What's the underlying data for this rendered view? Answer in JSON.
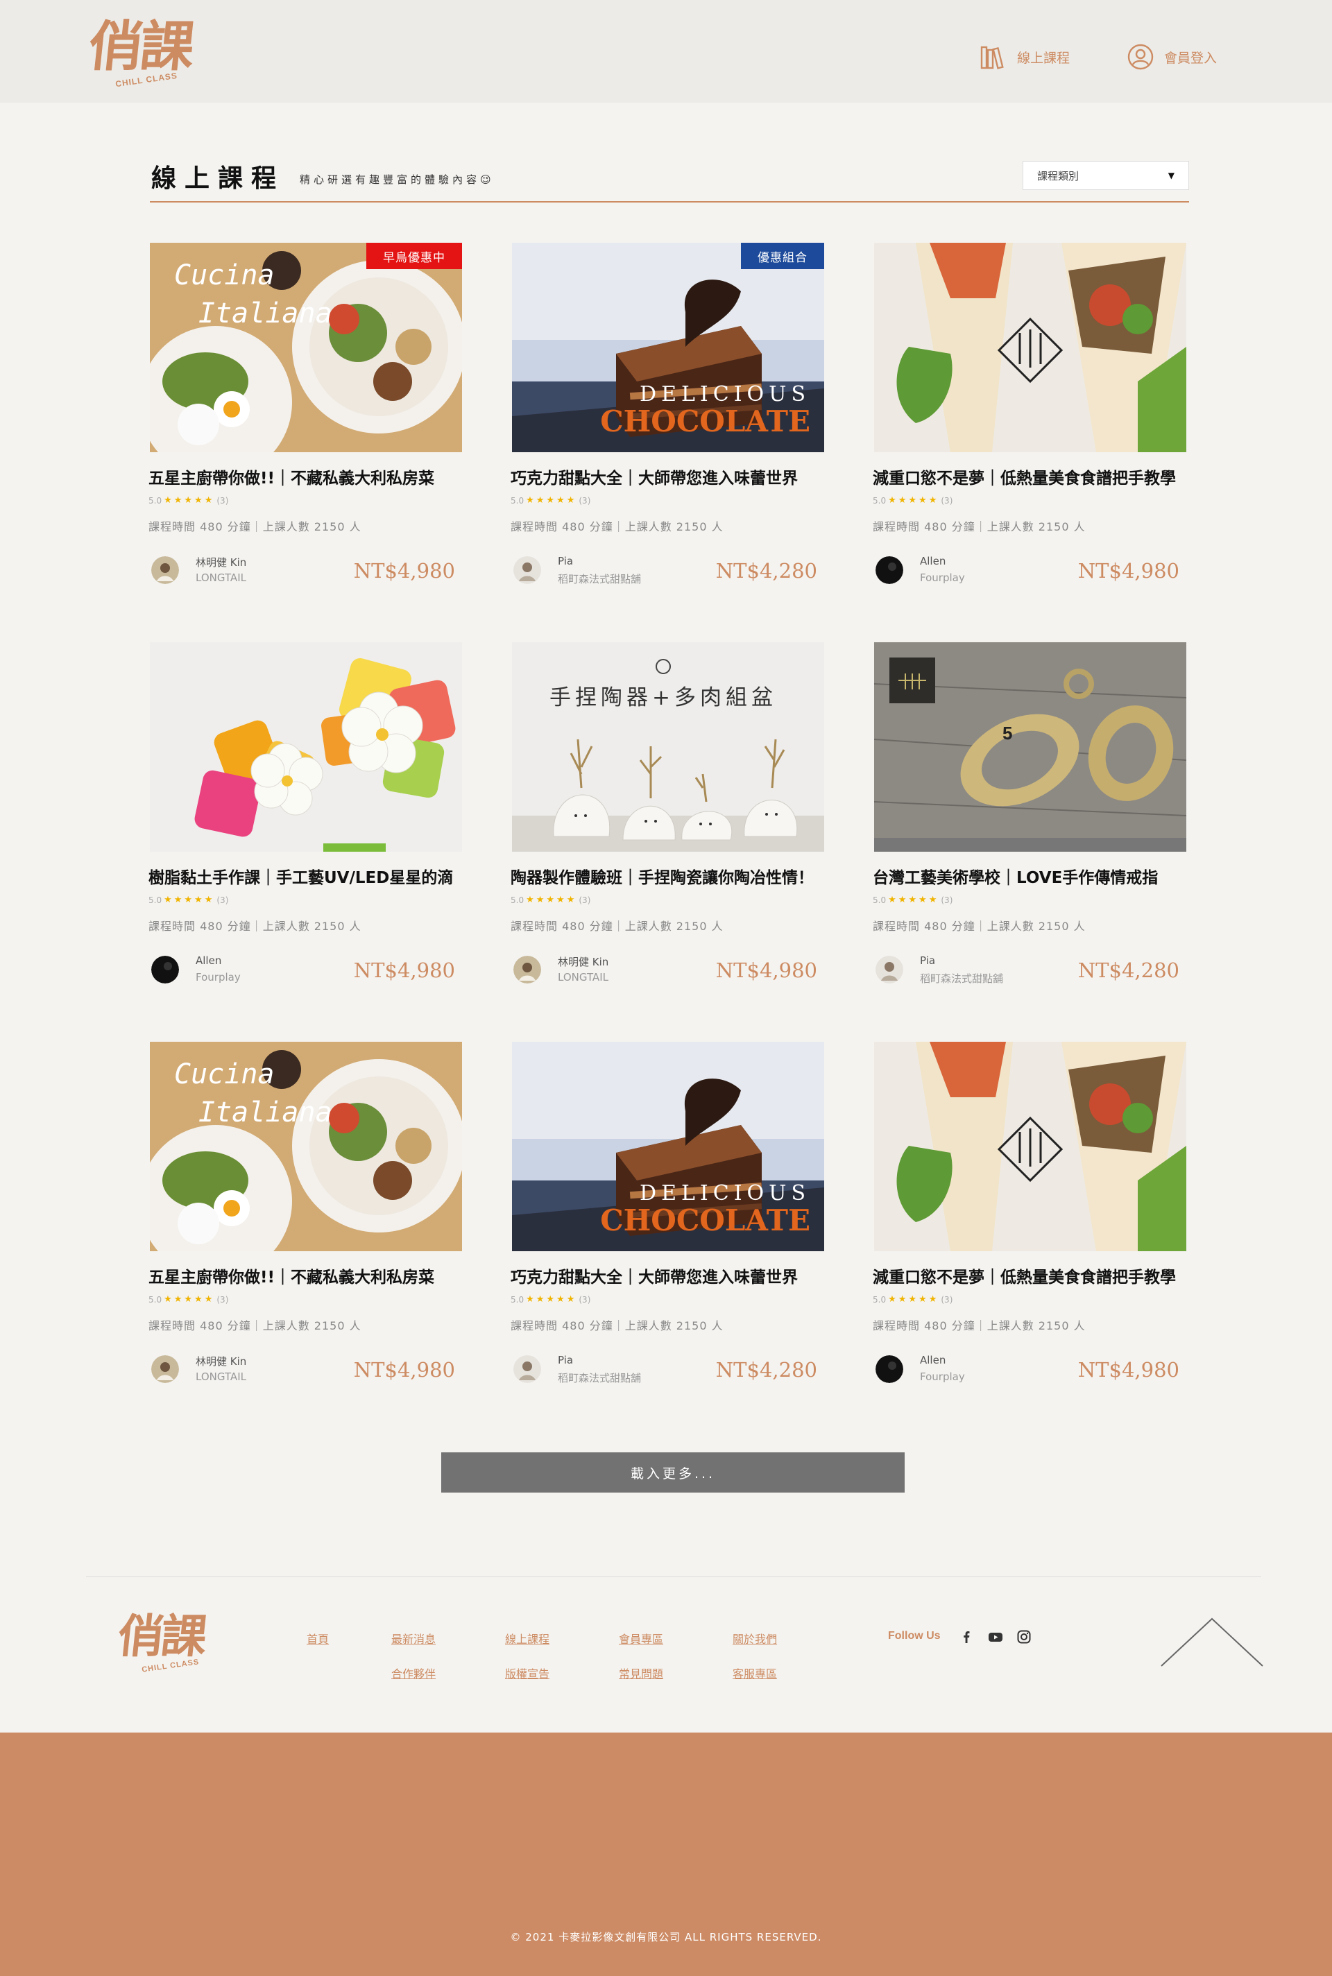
{
  "header": {
    "logo_text": "俏課",
    "logo_sub": "CHILL CLASS",
    "nav": [
      {
        "label": "線上課程",
        "icon": "books-icon"
      },
      {
        "label": "會員登入",
        "icon": "user-icon"
      }
    ]
  },
  "section": {
    "title": "線上課程",
    "subtitle": "精心研選有趣豐富的體驗內容😉",
    "category_select": "課程類別"
  },
  "courses": [
    {
      "title": "五星主廚帶你做!!｜不藏私義大利私房菜",
      "rating": "5.0",
      "reviews": "(3)",
      "meta": "課程時間  480  分鐘｜上課人數  2150  人",
      "teacher": "林明健 Kin",
      "org": "LONGTAIL",
      "price": "NT$4,980",
      "badge": "早鳥優惠中",
      "image": "italian-food"
    },
    {
      "title": "巧克力甜點大全｜大師帶您進入味蕾世界",
      "rating": "5.0",
      "reviews": "(3)",
      "meta": "課程時間  480  分鐘｜上課人數  2150  人",
      "teacher": "Pia",
      "org": "稻町森法式甜點舖",
      "price": "NT$4,280",
      "badge": "優惠組合",
      "image": "chocolate-cake",
      "image_text_1": "DELICIOUS",
      "image_text_2": "CHOCOLATE"
    },
    {
      "title": "減重口慾不是夢｜低熱量美食食譜把手教學",
      "rating": "5.0",
      "reviews": "(3)",
      "meta": "課程時間  480  分鐘｜上課人數  2150  人",
      "teacher": "Allen",
      "org": "Fourplay",
      "price": "NT$4,980",
      "image": "wraps"
    },
    {
      "title": "樹脂黏土手作課｜手工藝UV/LED星星的滴",
      "rating": "5.0",
      "reviews": "(3)",
      "meta": "課程時間  480  分鐘｜上課人數  2150  人",
      "teacher": "Allen",
      "org": "Fourplay",
      "price": "NT$4,980",
      "image": "resin-craft"
    },
    {
      "title": "陶器製作體驗班｜手捏陶瓷讓你陶冶性情！",
      "rating": "5.0",
      "reviews": "(3)",
      "meta": "課程時間  480  分鐘｜上課人數  2150  人",
      "teacher": "林明健 Kin",
      "org": "LONGTAIL",
      "price": "NT$4,980",
      "image": "pottery",
      "image_text_1": "手捏陶器+多肉組盆"
    },
    {
      "title": "台灣工藝美術學校｜LOVE手作傳情戒指",
      "rating": "5.0",
      "reviews": "(3)",
      "meta": "課程時間  480  分鐘｜上課人數  2150  人",
      "teacher": "Pia",
      "org": "稻町森法式甜點舖",
      "price": "NT$4,280",
      "image": "tape-rings"
    },
    {
      "title": "五星主廚帶你做!!｜不藏私義大利私房菜",
      "rating": "5.0",
      "reviews": "(3)",
      "meta": "課程時間  480  分鐘｜上課人數  2150  人",
      "teacher": "林明健 Kin",
      "org": "LONGTAIL",
      "price": "NT$4,980",
      "image": "italian-food"
    },
    {
      "title": "巧克力甜點大全｜大師帶您進入味蕾世界",
      "rating": "5.0",
      "reviews": "(3)",
      "meta": "課程時間  480  分鐘｜上課人數  2150  人",
      "teacher": "Pia",
      "org": "稻町森法式甜點舖",
      "price": "NT$4,280",
      "image": "chocolate-cake",
      "image_text_1": "DELICIOUS",
      "image_text_2": "CHOCOLATE"
    },
    {
      "title": "減重口慾不是夢｜低熱量美食食譜把手教學",
      "rating": "5.0",
      "reviews": "(3)",
      "meta": "課程時間  480  分鐘｜上課人數  2150  人",
      "teacher": "Allen",
      "org": "Fourplay",
      "price": "NT$4,980",
      "image": "wraps"
    }
  ],
  "load_more": "載入更多...",
  "footer": {
    "logo_text": "俏課",
    "logo_sub": "CHILL CLASS",
    "links_row1": [
      "首頁",
      "最新消息",
      "線上課程",
      "會員專區",
      "關於我們"
    ],
    "links_row2": [
      "合作夥伴",
      "版權宣告",
      "常見問題",
      "客服專區"
    ],
    "follow": "Follow Us",
    "social": [
      "facebook-icon",
      "youtube-icon",
      "instagram-icon"
    ],
    "copyright": "©  2021  卡麥拉影像文創有限公司  ALL  RIGHTS  RESERVED."
  },
  "colors": {
    "brand": "#cd8b62",
    "bg": "#f4f3f0",
    "header_bg": "#ecebe7",
    "footer_bar": "#cd8b65",
    "badge_red": "#e41414",
    "badge_blue": "#1d4a9a",
    "star": "#f0b400"
  }
}
